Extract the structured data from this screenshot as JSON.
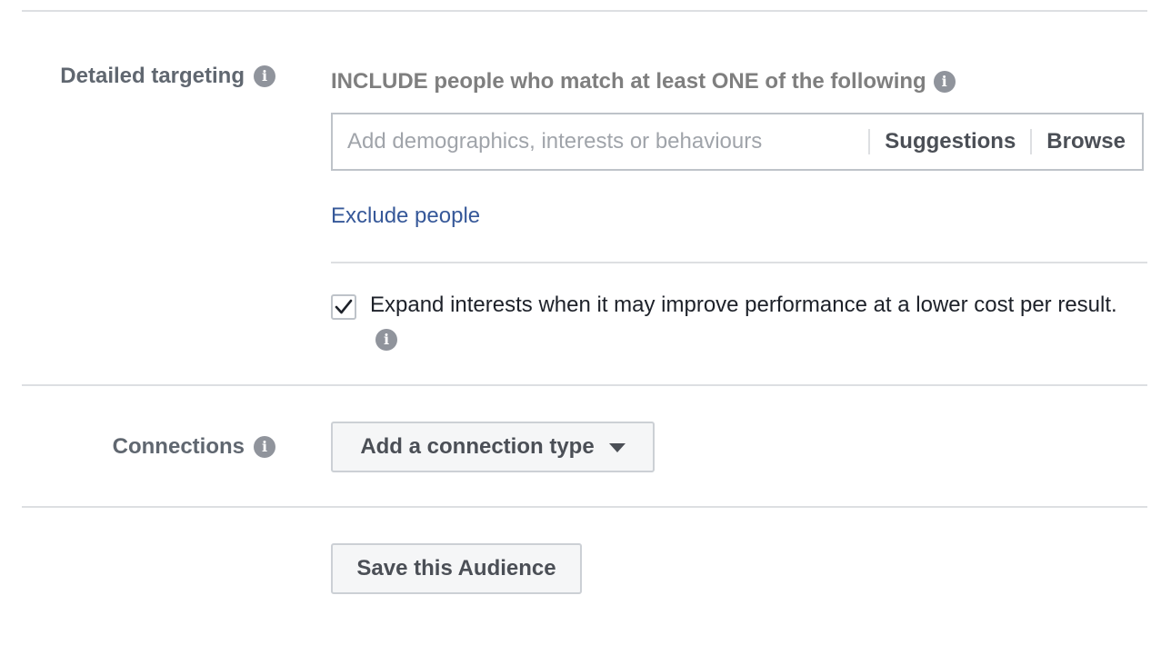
{
  "detailed_targeting": {
    "label": "Detailed targeting",
    "info_icon": "info-icon",
    "include_text": "INCLUDE people who match at least ONE of the following",
    "search_placeholder": "Add demographics, interests or behaviours",
    "search_value": "",
    "suggestions_label": "Suggestions",
    "browse_label": "Browse",
    "exclude_link": "Exclude people",
    "expand_checked": true,
    "expand_text": "Expand interests when it may improve performance at a lower cost per result."
  },
  "connections": {
    "label": "Connections",
    "info_icon": "info-icon",
    "dropdown_label": "Add a connection type",
    "dropdown_icon": "caret-down-icon"
  },
  "save_audience_label": "Save this Audience",
  "colors": {
    "link": "#365899",
    "label": "#606770",
    "divider": "#dddfe2",
    "button_bg": "#f5f6f7"
  }
}
